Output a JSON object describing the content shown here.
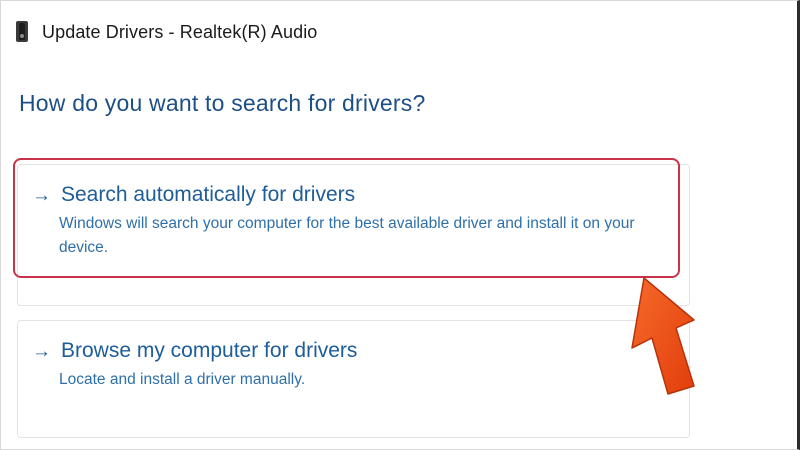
{
  "window": {
    "title": "Update Drivers - Realtek(R) Audio",
    "icon": "audio-device-icon"
  },
  "page": {
    "question": "How do you want to search for drivers?"
  },
  "options": [
    {
      "title": "Search automatically for drivers",
      "description": "Windows will search your computer for the best available driver and install it on your device.",
      "icon": "arrow-right-icon",
      "highlighted": true
    },
    {
      "title": "Browse my computer for drivers",
      "description": "Locate and install a driver manually.",
      "icon": "arrow-right-icon",
      "highlighted": false
    }
  ],
  "annotation": {
    "highlight_color": "#c8334a",
    "arrow_color": "#ef4b16"
  },
  "colors": {
    "link_blue": "#1d5d99",
    "heading_blue": "#1d4f87"
  }
}
